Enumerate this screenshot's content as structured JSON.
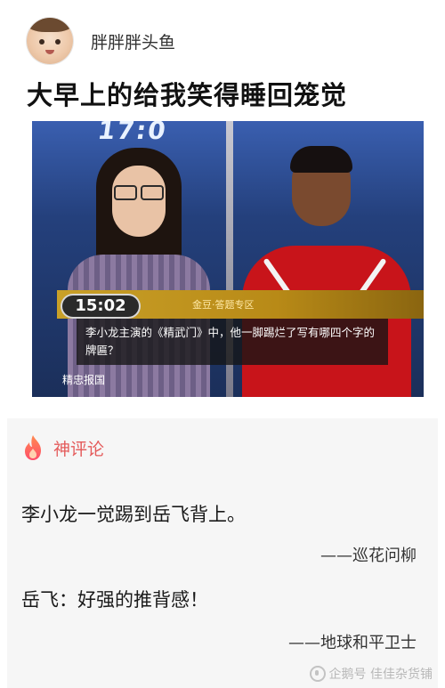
{
  "post": {
    "author_name": "胖胖胖头鱼",
    "title": "大早上的给我笑得睡回笼觉",
    "image": {
      "logo_text": "17:0",
      "timer": "15:02",
      "quiz_tag": "金豆·答题专区",
      "question": "李小龙主演的《精武门》中，他一脚踢烂了写有哪四个字的牌匾？",
      "answer": "精忠报国"
    }
  },
  "comments_section": {
    "header_label": "神评论",
    "comments": [
      {
        "text": "李小龙一觉踢到岳飞背上。",
        "attribution": "——巡花问柳"
      },
      {
        "text": "岳飞：好强的推背感！",
        "attribution": "——地球和平卫士"
      }
    ],
    "watermark": "企鹅号 佳佳杂货铺"
  },
  "icons": {
    "avatar": "avatar",
    "header_icon": "flame-icon",
    "watermark_icon": "penguin-icon"
  },
  "colors": {
    "title_text": "#111111",
    "god_comment_label": "#e45a5a",
    "section_background": "#f6f6f6"
  }
}
